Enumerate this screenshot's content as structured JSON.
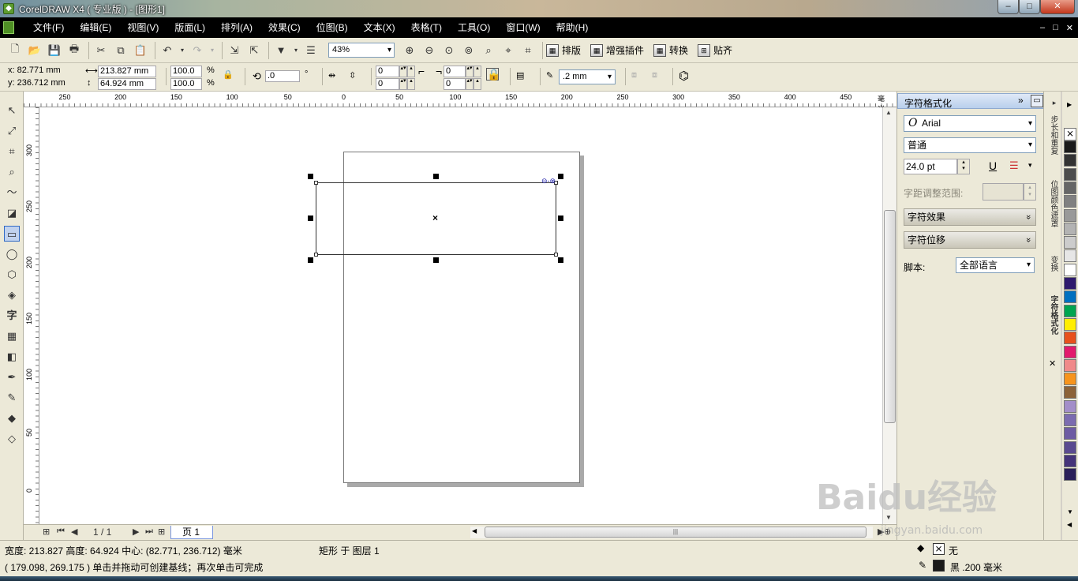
{
  "window": {
    "title": "CorelDRAW X4 ( 专业版 ) - [图形1]",
    "min_glyph": "–",
    "max_glyph": "□",
    "close_glyph": "✕"
  },
  "menu": [
    "文件(F)",
    "编辑(E)",
    "视图(V)",
    "版面(L)",
    "排列(A)",
    "效果(C)",
    "位图(B)",
    "文本(X)",
    "表格(T)",
    "工具(O)",
    "窗口(W)",
    "帮助(H)"
  ],
  "mdi_buttons": [
    "–",
    "□",
    "✕"
  ],
  "toolbar": {
    "zoom": "43%",
    "btn_layout": "排版",
    "btn_plugins": "增强插件",
    "btn_convert": "转换",
    "btn_snap": "贴齐"
  },
  "property_bar": {
    "x": "x: 82.771 mm",
    "y": "y: 236.712 mm",
    "width": "213.827 mm",
    "height": "64.924 mm",
    "scale_w": "100.0",
    "scale_h": "100.0",
    "pct": "%",
    "rotation": ".0",
    "deg": "°",
    "corner_tl": "0",
    "corner_bl": "0",
    "corner_tr": "0",
    "corner_br": "0",
    "outline_width": ".2 mm"
  },
  "ruler_h": [
    "250",
    "200",
    "150",
    "100",
    "50",
    "0",
    "50",
    "100",
    "150",
    "200",
    "250",
    "300",
    "350",
    "400",
    "450"
  ],
  "ruler_h_unit": "毫米",
  "ruler_v": [
    "300",
    "250",
    "200",
    "150",
    "100",
    "50",
    "0"
  ],
  "page_nav": {
    "counter": "1 / 1",
    "tab": "页 1"
  },
  "docker": {
    "title": "字符格式化",
    "font": "Arial",
    "style": "普通",
    "size": "24.0 pt",
    "kerning_label": "字距调整范围:",
    "section_effects": "字符效果",
    "section_offset": "字符位移",
    "script_label": "脚本:",
    "script_value": "全部语言"
  },
  "side_tabs": [
    "步长和重复",
    "位图颜色遮罩",
    "变换",
    "字符格式化"
  ],
  "palette_colors": [
    "#ffffff",
    "#1a1a1a",
    "#333333",
    "#4d4d4d",
    "#666666",
    "#808080",
    "#999999",
    "#b3b3b3",
    "#cccccc",
    "#e6e6e6",
    "#ffffff",
    "#2e1a6e",
    "#0070c0",
    "#00a550",
    "#ffee00",
    "#e8501c",
    "#e2196d",
    "#f08a8a",
    "#f7941d",
    "#8c6239",
    "#a38ec9",
    "#7b6bb0",
    "#6d5ba3",
    "#5a4a90",
    "#44337a",
    "#2a1f5a"
  ],
  "status": {
    "line1": "宽度: 213.827  高度: 64.924  中心: (82.771, 236.712)  毫米",
    "object_info": "矩形 于 图层 1",
    "line2": "( 179.098, 269.175 )     单击并拖动可创建基线；再次单击可完成",
    "fill_label": "无",
    "outline_label": "黑  .200 毫米"
  },
  "watermark": {
    "main": "Baidu经验",
    "sub": "jingyan.baidu.com"
  }
}
